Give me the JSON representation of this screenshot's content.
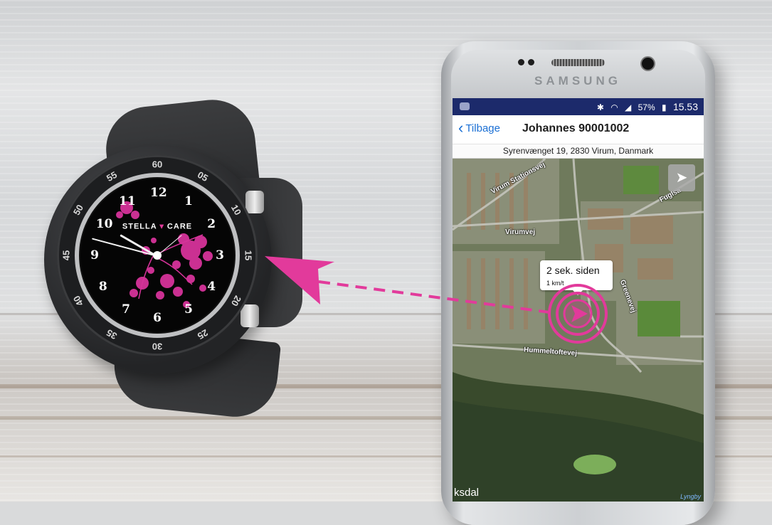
{
  "watch": {
    "brand_left": "STELLA",
    "brand_right": "CARE",
    "bezel_numbers": [
      "60",
      "05",
      "10",
      "15",
      "20",
      "25",
      "30",
      "35",
      "40",
      "45",
      "50",
      "55"
    ],
    "dial_numbers": [
      "12",
      "1",
      "2",
      "3",
      "4",
      "5",
      "6",
      "7",
      "8",
      "9",
      "10",
      "11"
    ]
  },
  "phone": {
    "brand": "SAMSUNG",
    "statusbar": {
      "battery": "57%",
      "time": "15.53"
    },
    "navbar": {
      "back_label": "Tilbage",
      "title": "Johannes 90001002"
    },
    "address": "Syrenvænget 19, 2830 Virum, Danmark",
    "map": {
      "road_labels": {
        "station": "Virum Stationsvej",
        "virumvej": "Virumvej",
        "hummeltoftevej": "Hummeltoftevej",
        "fuglsa": "Fuglsa",
        "green": "Greenevej"
      },
      "info_bubble": {
        "time": "2 sek. siden",
        "speed": "1 km/t"
      },
      "attribution": "ksdal",
      "place": "Lyngby"
    }
  },
  "colors": {
    "accent_pink": "#e23a9b",
    "statusbar_blue": "#1c2a6b",
    "link_blue": "#1a6fd4"
  }
}
